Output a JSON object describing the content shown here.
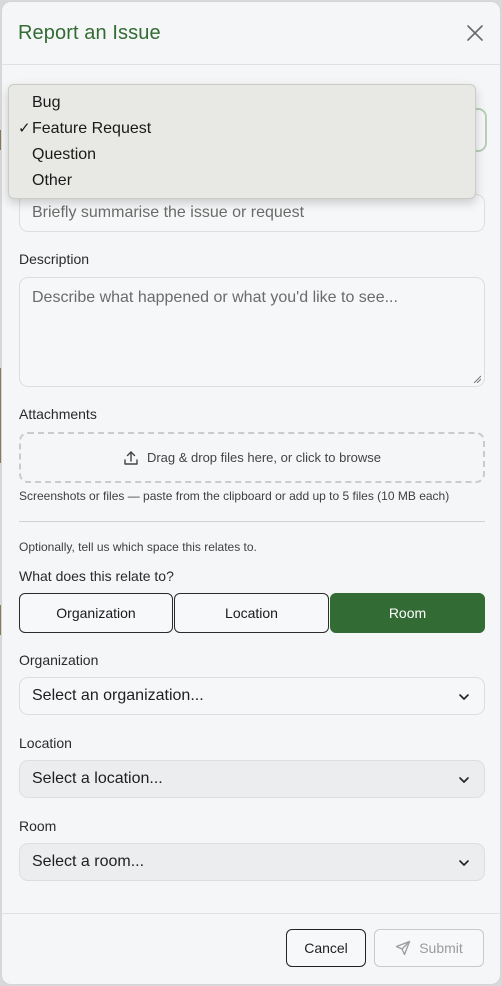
{
  "dialog": {
    "title": "Report an Issue",
    "close_icon": "close-icon"
  },
  "type_menu": {
    "selected": "Feature Request",
    "options": [
      "Bug",
      "Feature Request",
      "Question",
      "Other"
    ],
    "check_mark": "✓"
  },
  "title_field": {
    "placeholder": "Briefly summarise the issue or request"
  },
  "description": {
    "label": "Description",
    "placeholder": "Describe what happened or what you'd like to see..."
  },
  "attachments": {
    "label": "Attachments",
    "dropzone_text": "Drag & drop files here, or click to browse",
    "helper": "Screenshots or files — paste from the clipboard or add up to 5 files (10 MB each)",
    "icon": "upload-icon"
  },
  "relation": {
    "hint": "Optionally, tell us which space this relates to.",
    "question": "What does this relate to?",
    "options": [
      "Organization",
      "Location",
      "Room"
    ],
    "selected": "Room"
  },
  "organization": {
    "label": "Organization",
    "placeholder": "Select an organization..."
  },
  "location": {
    "label": "Location",
    "placeholder": "Select a location..."
  },
  "room": {
    "label": "Room",
    "placeholder": "Select a room..."
  },
  "footer": {
    "cancel_label": "Cancel",
    "submit_label": "Submit",
    "submit_icon": "send-icon"
  },
  "colors": {
    "accent": "#336b34",
    "title": "#336b34",
    "background": "#f5f6f7"
  }
}
